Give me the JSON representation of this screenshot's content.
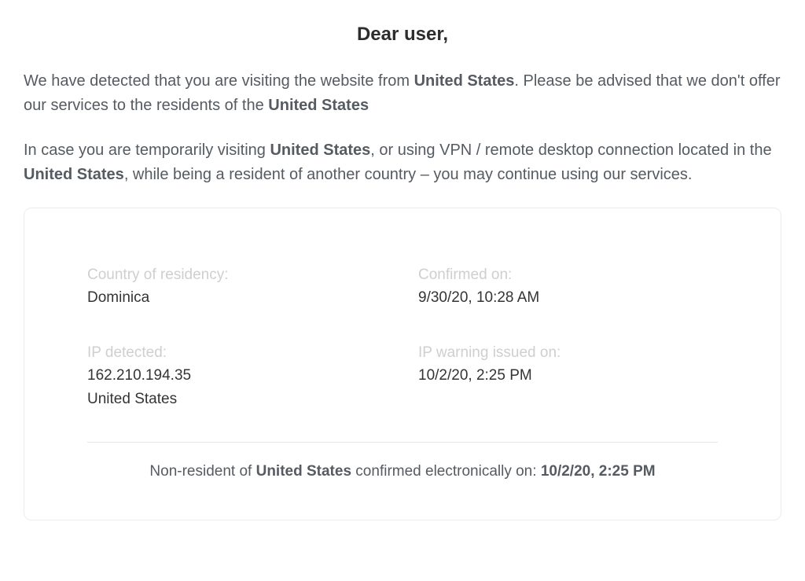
{
  "heading": "Dear user,",
  "para1": {
    "pre": "We have detected that you are visiting the website from ",
    "country1": "United States",
    "mid": ". Please be advised that we don't offer our services to the residents of the ",
    "country2": "United States"
  },
  "para2": {
    "pre": "In case you are temporarily visiting ",
    "country1": "United States",
    "mid1": ", or using VPN / remote desktop connection located in the ",
    "country2": "United States",
    "post": ", while being a resident of another country – you may continue using our services."
  },
  "card": {
    "residency": {
      "label": "Country of residency:",
      "value": "Dominica"
    },
    "confirmed": {
      "label": "Confirmed on:",
      "value": "9/30/20, 10:28 AM"
    },
    "ip": {
      "label": "IP detected:",
      "value_ip": "162.210.194.35",
      "value_country": "United States"
    },
    "warning": {
      "label": "IP warning issued on:",
      "value": "10/2/20, 2:25 PM"
    }
  },
  "footer": {
    "pre": "Non-resident of ",
    "country": "United States",
    "mid": " confirmed electronically on: ",
    "date": "10/2/20, 2:25 PM"
  }
}
